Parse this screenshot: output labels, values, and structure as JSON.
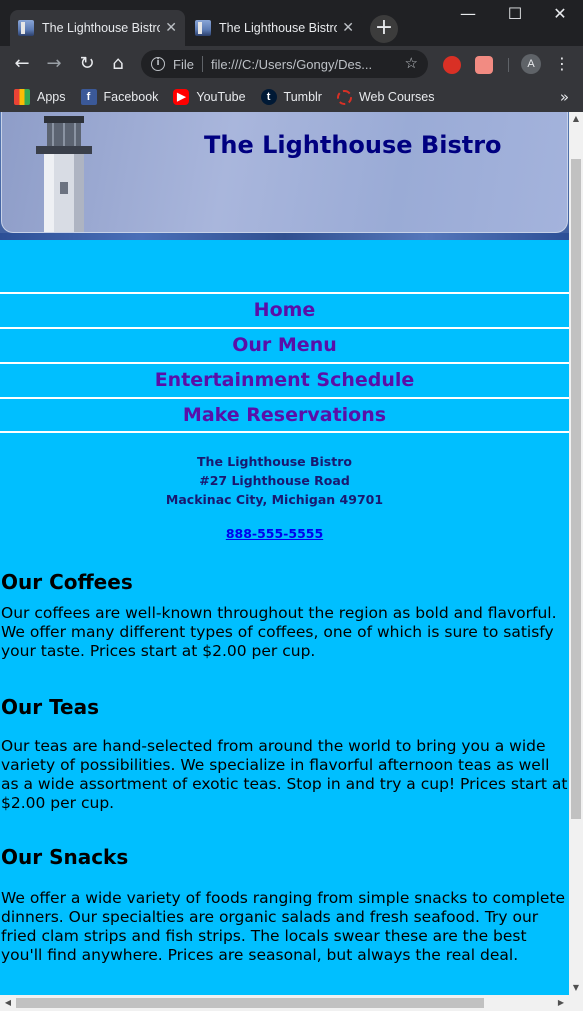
{
  "browser": {
    "tabs": [
      {
        "title": "The Lighthouse Bistro",
        "active": true
      },
      {
        "title": "The Lighthouse Bistro",
        "active": false
      }
    ],
    "address_bar": {
      "scheme_label": "File",
      "url": "file:///C:/Users/Gongy/Des..."
    },
    "profile_initial": "A",
    "bookmarks": [
      {
        "label": "Apps",
        "icon": "apps-grid-icon"
      },
      {
        "label": "Facebook",
        "icon": "facebook-icon"
      },
      {
        "label": "YouTube",
        "icon": "youtube-icon"
      },
      {
        "label": "Tumblr",
        "icon": "tumblr-icon"
      },
      {
        "label": "Web Courses",
        "icon": "web-courses-icon"
      }
    ]
  },
  "page": {
    "banner_title": "The Lighthouse Bistro",
    "nav": [
      "Home",
      "Our Menu",
      "Entertainment Schedule",
      "Make Reservations"
    ],
    "address": {
      "name": "The Lighthouse Bistro",
      "street": "#27 Lighthouse Road",
      "city": "Mackinac City, Michigan 49701",
      "phone": "888-555-5555"
    },
    "sections": [
      {
        "heading": "Our Coffees",
        "body": "Our coffees are well-known throughout the region as bold and flavorful. We offer many different types of coffees, one of which is sure to satisfy your taste. Prices start at $2.00 per cup."
      },
      {
        "heading": "Our Teas",
        "body": "Our teas are hand-selected from around the world to bring you a wide variety of possibilities. We specialize in flavorful afternoon teas as well as a wide assortment of exotic teas. Stop in and try a cup! Prices start at $2.00 per cup."
      },
      {
        "heading": "Our Snacks",
        "body": "We offer a wide variety of foods ranging from simple snacks to complete dinners. Our specialties are organic salads and fresh seafood. Try our fried clam strips and fish strips. The locals swear these are the best you'll find anywhere. Prices are seasonal, but always the real deal."
      }
    ]
  },
  "colors": {
    "page_background": "#00bfff",
    "nav_text": "#5a0fa8",
    "banner_title": "#000080",
    "address_text": "#191970",
    "link": "#0000ee"
  }
}
